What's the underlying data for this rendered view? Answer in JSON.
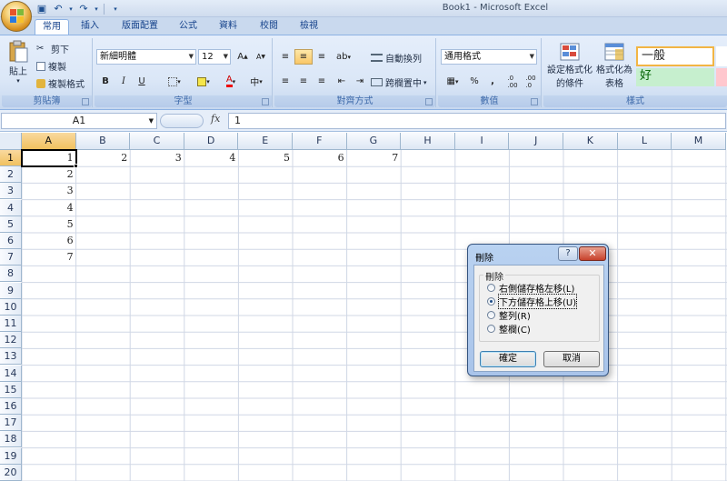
{
  "window": {
    "title": "Book1 - Microsoft Excel"
  },
  "tabs": [
    "常用",
    "插入",
    "版面配置",
    "公式",
    "資料",
    "校閱",
    "檢視"
  ],
  "ribbon": {
    "clipboard": {
      "paste": "貼上",
      "cut": "剪下",
      "copy": "複製",
      "format_painter": "複製格式",
      "label": "剪貼簿"
    },
    "font": {
      "name": "新細明體",
      "size": "12",
      "label": "字型",
      "bold": "B",
      "italic": "I",
      "underline": "U"
    },
    "alignment": {
      "wrap": "自動換列",
      "merge": "跨欄置中",
      "label": "對齊方式"
    },
    "number": {
      "format": "通用格式",
      "percent": "%",
      "comma": ",",
      "label": "數值"
    },
    "styles": {
      "conditional": "設定格式化",
      "conditional2": "的條件",
      "format_table": "格式化為",
      "format_table2": "表格",
      "normal": "一般",
      "good": "好",
      "label": "樣式"
    }
  },
  "formula_bar": {
    "name_box": "A1",
    "fx": "fx",
    "value": "1"
  },
  "columns": [
    "A",
    "B",
    "C",
    "D",
    "E",
    "F",
    "G",
    "H",
    "I",
    "J",
    "K",
    "L",
    "M"
  ],
  "rows": [
    "1",
    "2",
    "3",
    "4",
    "5",
    "6",
    "7",
    "8",
    "9",
    "10",
    "11",
    "12",
    "13",
    "14",
    "15",
    "16",
    "17",
    "18",
    "19",
    "20"
  ],
  "cells": {
    "A1": "1",
    "B1": "2",
    "C1": "3",
    "D1": "4",
    "E1": "5",
    "F1": "6",
    "G1": "7",
    "A2": "2",
    "A3": "3",
    "A4": "4",
    "A5": "5",
    "A6": "6",
    "A7": "7"
  },
  "dialog": {
    "title": "刪除",
    "help": "?",
    "close": "✕",
    "group_label": "刪除",
    "options": [
      {
        "label": "右側儲存格左移(L)",
        "selected": false
      },
      {
        "label": "下方儲存格上移(U)",
        "selected": true
      },
      {
        "label": "整列(R)",
        "selected": false
      },
      {
        "label": "整欄(C)",
        "selected": false
      }
    ],
    "ok": "確定",
    "cancel": "取消"
  }
}
